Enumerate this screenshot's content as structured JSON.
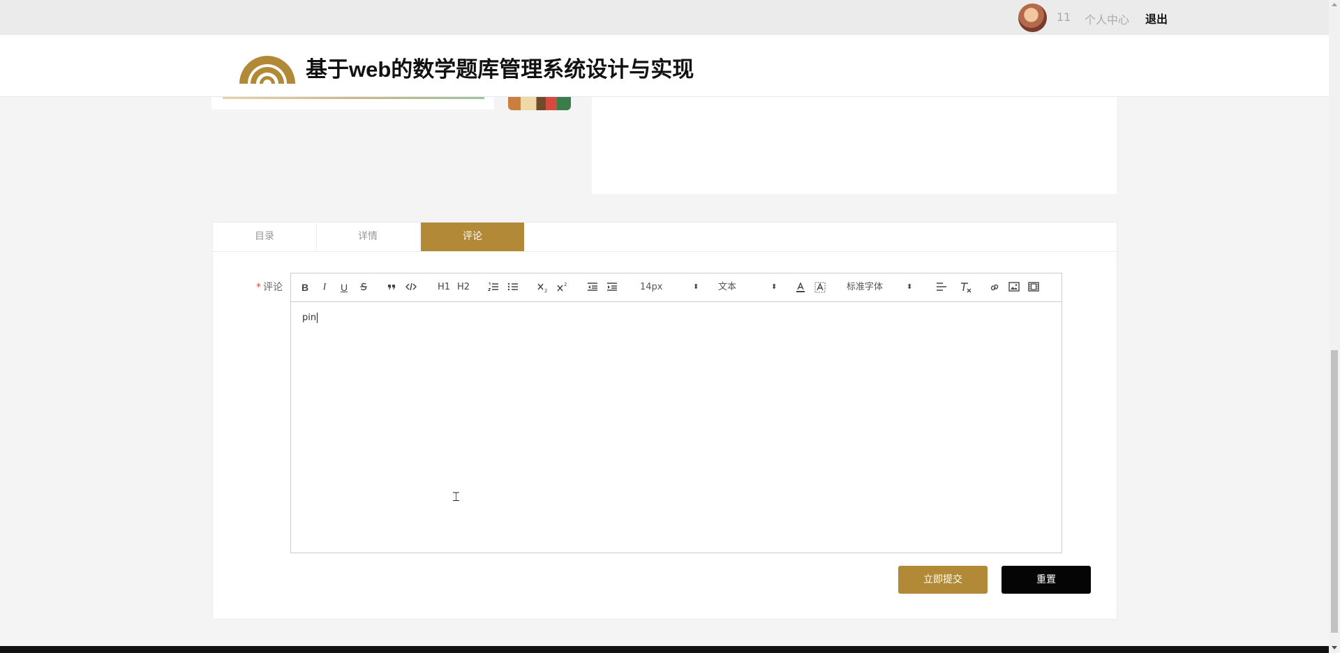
{
  "topbar": {
    "username": "11",
    "profile_link": "个人中心",
    "logout_link": "退出"
  },
  "header": {
    "site_title": "基于web的数学题库管理系统设计与实现"
  },
  "tabs": [
    {
      "label": "目录",
      "active": false
    },
    {
      "label": "详情",
      "active": false
    },
    {
      "label": "评论",
      "active": true
    }
  ],
  "comment_form": {
    "label": "评论",
    "required_mark": "*",
    "content": "pin",
    "submit_label": "立即提交",
    "reset_label": "重置"
  },
  "editor_toolbar": {
    "bold": "B",
    "italic": "I",
    "underline": "U",
    "h1": "H1",
    "h2": "H2",
    "size_select": "14px",
    "header_select": "文本",
    "font_select": "标准字体"
  },
  "colors": {
    "accent": "#b28a37",
    "reset_button": "#050505",
    "topbar_bg": "#ebebeb",
    "page_bg": "#f4f4f4"
  }
}
